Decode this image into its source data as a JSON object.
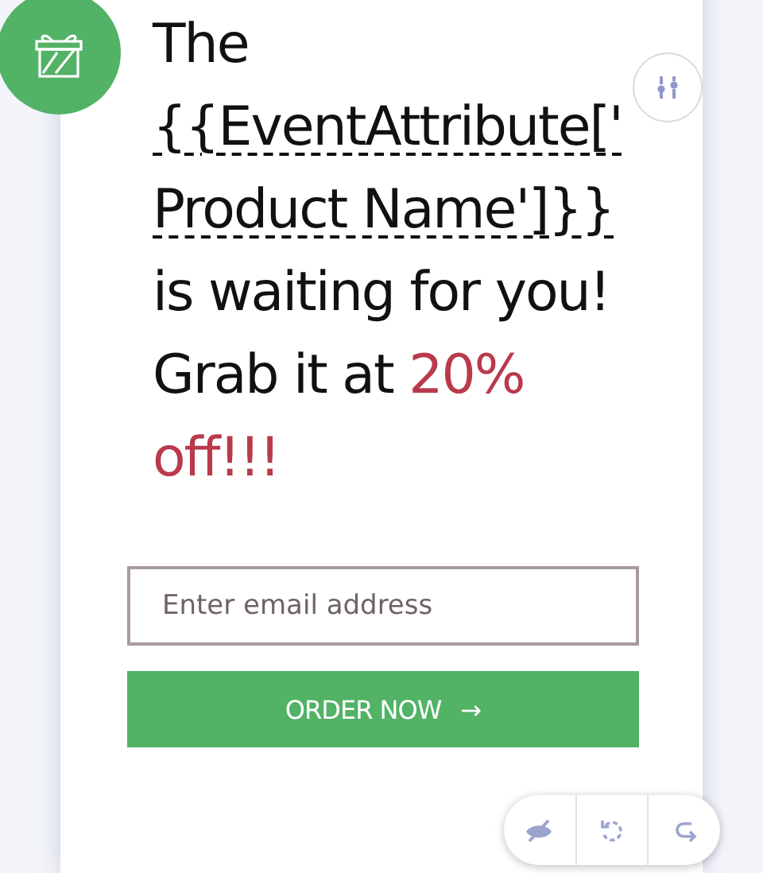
{
  "headline": [
    {
      "text": "The ",
      "kind": "plain"
    },
    {
      "text": "{{EventAttribute['Product Name']}}",
      "kind": "placeholder"
    },
    {
      "text": " is waiting for you! Grab it at ",
      "kind": "plain"
    },
    {
      "text": "20% off!!!",
      "kind": "highlight"
    }
  ],
  "email_field": {
    "placeholder": "Enter email address"
  },
  "order_button": {
    "label": "ORDER NOW",
    "arrow": "→"
  }
}
